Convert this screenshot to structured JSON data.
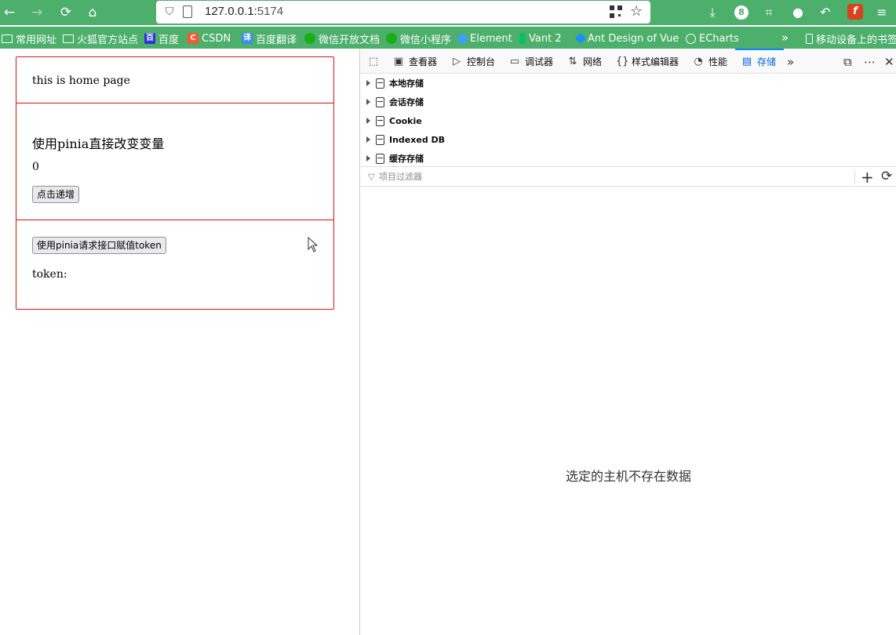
{
  "browser": {
    "url_host": "127.0.0.1:",
    "url_port": "5174",
    "badge_count": "8",
    "bookmarks": [
      {
        "label": "常用网址",
        "icon": "folder-icon"
      },
      {
        "label": "火狐官方站点",
        "icon": "folder-icon"
      },
      {
        "label": "百度",
        "icon": "baidu-icon",
        "color": "#2932e1"
      },
      {
        "label": "CSDN",
        "icon": "csdn-icon",
        "color": "#fc5531"
      },
      {
        "label": "百度翻译",
        "icon": "translate-icon",
        "color": "#3a8bf0"
      },
      {
        "label": "微信开放文档",
        "icon": "wechat-icon",
        "color": "#1aad19"
      },
      {
        "label": "微信小程序",
        "icon": "wechat-icon",
        "color": "#1aad19"
      },
      {
        "label": "Element",
        "icon": "element-icon",
        "color": "#409eff"
      },
      {
        "label": "Vant 2",
        "icon": "vant-icon",
        "color": "#07c160"
      },
      {
        "label": "Ant Design of Vue",
        "icon": "ant-design-icon",
        "color": "#1890ff"
      },
      {
        "label": "ECharts",
        "icon": "globe-icon"
      }
    ],
    "mobile_bookmarks": "移动设备上的书签"
  },
  "page": {
    "home_text": "this is home page",
    "pinia_heading": "使用pinia直接改变变量",
    "count_value": "0",
    "increment_button": "点击递增",
    "token_button": "使用pinia请求接口赋值token",
    "token_label": "token:"
  },
  "devtools": {
    "tabs": [
      {
        "label": "",
        "icon": "pick-element-icon"
      },
      {
        "label": "查看器",
        "icon": "inspector-icon"
      },
      {
        "label": "控制台",
        "icon": "console-icon"
      },
      {
        "label": "调试器",
        "icon": "debugger-icon"
      },
      {
        "label": "网络",
        "icon": "network-icon"
      },
      {
        "label": "样式编辑器",
        "icon": "style-editor-icon"
      },
      {
        "label": "性能",
        "icon": "performance-icon"
      },
      {
        "label": "存储",
        "icon": "storage-icon",
        "active": true
      }
    ],
    "storage_tree": [
      "本地存储",
      "会话存储",
      "Cookie",
      "Indexed DB",
      "缓存存储"
    ],
    "filter_placeholder": "项目过滤器",
    "empty_message": "选定的主机不存在数据",
    "accent_color": "#0a84ff"
  }
}
